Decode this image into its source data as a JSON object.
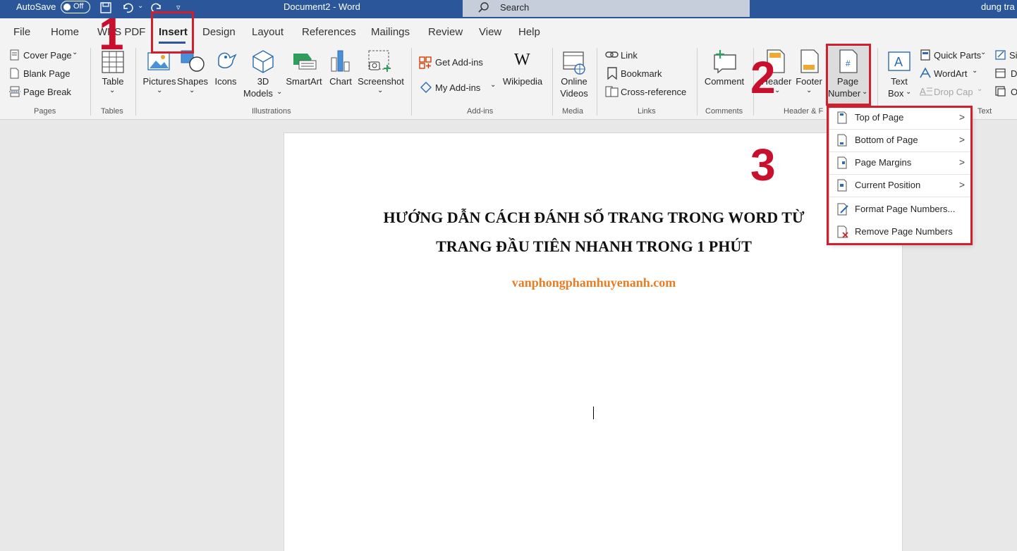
{
  "titlebar": {
    "autosave": "AutoSave",
    "toggle": "Off",
    "doc_title": "Document2  -  Word",
    "search_placeholder": "Search",
    "user": "dung tra"
  },
  "tabs": [
    "File",
    "Home",
    "WPS PDF",
    "Insert",
    "Design",
    "Layout",
    "References",
    "Mailings",
    "Review",
    "View",
    "Help"
  ],
  "ribbon": {
    "pages": {
      "cover": "Cover Page",
      "blank": "Blank Page",
      "break": "Page Break",
      "group": "Pages"
    },
    "tables": {
      "table": "Table",
      "group": "Tables"
    },
    "illustrations": {
      "pictures": "Pictures",
      "shapes": "Shapes",
      "icons": "Icons",
      "models_1": "3D",
      "models_2": "Models",
      "smartart": "SmartArt",
      "chart": "Chart",
      "screenshot": "Screenshot",
      "group": "Illustrations"
    },
    "addins": {
      "get": "Get Add-ins",
      "my": "My Add-ins",
      "wikipedia": "Wikipedia",
      "group": "Add-ins"
    },
    "media": {
      "online_1": "Online",
      "online_2": "Videos",
      "group": "Media"
    },
    "links": {
      "link": "Link",
      "bookmark": "Bookmark",
      "cross": "Cross-reference",
      "group": "Links"
    },
    "comments": {
      "comment": "Comment",
      "group": "Comments"
    },
    "header_footer": {
      "header": "Header",
      "footer": "Footer",
      "page_1": "Page",
      "page_2": "Number",
      "group": "Header & F"
    },
    "text": {
      "textbox_1": "Text",
      "textbox_2": "Box",
      "quickparts": "Quick Parts",
      "wordart": "WordArt",
      "dropcap": "Drop Cap",
      "s": "Si",
      "d": "D",
      "o": "O",
      "group": "Text"
    }
  },
  "menu": {
    "items": [
      {
        "label": "Top of Page",
        "submenu": true
      },
      {
        "label": "Bottom of Page",
        "submenu": true
      },
      {
        "label": "Page Margins",
        "submenu": true
      },
      {
        "label": "Current Position",
        "submenu": true
      },
      {
        "label": "Format Page Numbers...",
        "submenu": false
      },
      {
        "label": "Remove Page Numbers",
        "submenu": false
      }
    ]
  },
  "document": {
    "title_line1": "HƯỚNG DẪN CÁCH ĐÁNH SỐ TRANG TRONG WORD TỪ",
    "title_line2": "TRANG ĐẦU TIÊN NHANH TRONG 1 PHÚT",
    "url": "vanphongphamhuyenanh.com"
  },
  "annotations": {
    "step1": "1",
    "step2": "2",
    "step3": "3"
  },
  "colors": {
    "titlebar": "#2b579a",
    "accent": "#2b579a",
    "annotation_red": "#d21f2e",
    "url_orange": "#e87d22"
  }
}
